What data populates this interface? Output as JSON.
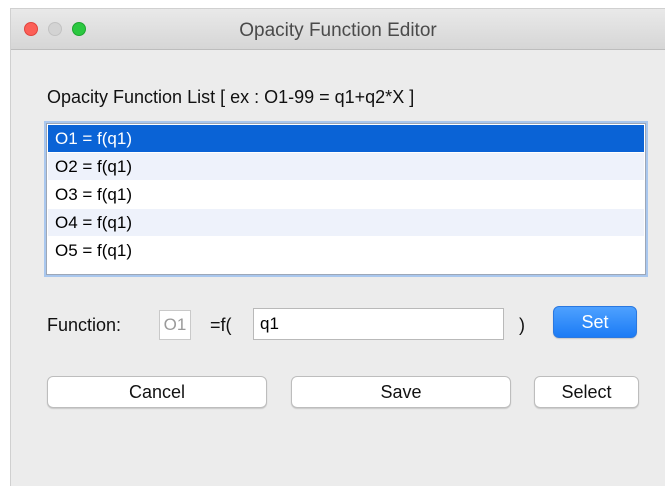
{
  "window": {
    "title": "Opacity Function Editor"
  },
  "list": {
    "heading": "Opacity Function List [ ex : O1-99 = q1+q2*X ]",
    "items": [
      {
        "label": "O1 = f(q1)",
        "selected": true
      },
      {
        "label": "O2 = f(q1)",
        "selected": false
      },
      {
        "label": "O3 = f(q1)",
        "selected": false
      },
      {
        "label": "O4 = f(q1)",
        "selected": false
      },
      {
        "label": "O5 = f(q1)",
        "selected": false
      }
    ]
  },
  "function": {
    "label": "Function:",
    "id": "O1",
    "prefix": "=f(",
    "value": "q1",
    "suffix": ")",
    "set_label": "Set"
  },
  "buttons": {
    "cancel": "Cancel",
    "save": "Save",
    "select": "Select"
  },
  "colors": {
    "selection": "#0a63d6",
    "set_button": "#1b7bf5",
    "close_light": "#fc5f57",
    "zoom_light": "#2bc840"
  }
}
